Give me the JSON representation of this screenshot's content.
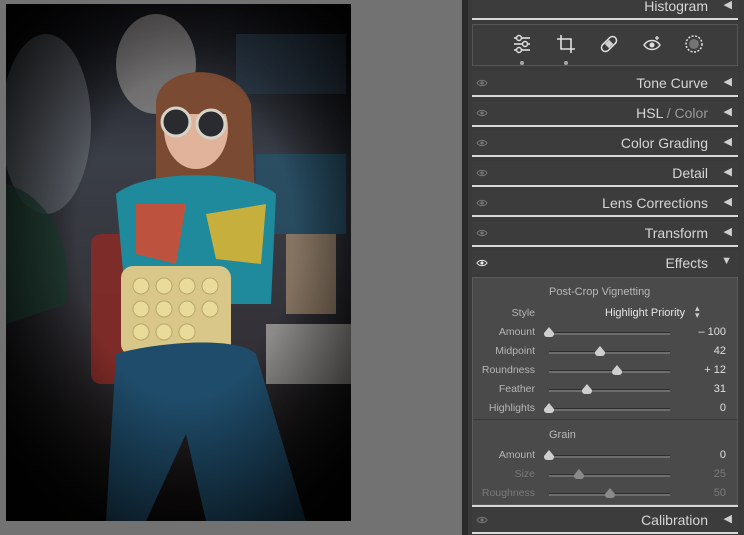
{
  "panels": {
    "histogram": {
      "title": "Histogram",
      "arrow": "◀"
    },
    "tone_curve": {
      "title": "Tone Curve",
      "arrow": "◀"
    },
    "hsl": {
      "title_a": "HSL",
      "sep": " / ",
      "title_b": "Color",
      "arrow": "◀"
    },
    "color_grading": {
      "title": "Color Grading",
      "arrow": "◀"
    },
    "detail": {
      "title": "Detail",
      "arrow": "◀"
    },
    "lens_corrections": {
      "title": "Lens Corrections",
      "arrow": "◀"
    },
    "transform": {
      "title": "Transform",
      "arrow": "◀"
    },
    "effects": {
      "title": "Effects",
      "arrow": "▼"
    },
    "calibration": {
      "title": "Calibration",
      "arrow": "◀"
    }
  },
  "tools": [
    "edit-sliders-icon",
    "crop-icon",
    "healing-bandage-icon",
    "red-eye-icon",
    "masking-icon"
  ],
  "effects": {
    "vignette": {
      "section_title": "Post-Crop Vignetting",
      "style_label": "Style",
      "style_value": "Highlight Priority",
      "sliders": [
        {
          "label": "Amount",
          "value": "– 100",
          "level": -100,
          "min": -100,
          "max": 100
        },
        {
          "label": "Midpoint",
          "value": "42",
          "level": 42,
          "min": 0,
          "max": 100
        },
        {
          "label": "Roundness",
          "value": "+ 12",
          "level": 12,
          "min": -100,
          "max": 100
        },
        {
          "label": "Feather",
          "value": "31",
          "level": 31,
          "min": 0,
          "max": 100
        },
        {
          "label": "Highlights",
          "value": "0",
          "level": 0,
          "min": 0,
          "max": 100
        }
      ]
    },
    "grain": {
      "section_title": "Grain",
      "sliders": [
        {
          "label": "Amount",
          "value": "0",
          "level": 0,
          "min": 0,
          "max": 100,
          "disabled": false
        },
        {
          "label": "Size",
          "value": "25",
          "level": 25,
          "min": 0,
          "max": 100,
          "disabled": true
        },
        {
          "label": "Roughness",
          "value": "50",
          "level": 50,
          "min": 0,
          "max": 100,
          "disabled": true
        }
      ]
    }
  },
  "colors": {
    "panel_bg": "#3a3a3a",
    "canvas_bg": "#727272",
    "text": "#d6d6d6"
  }
}
